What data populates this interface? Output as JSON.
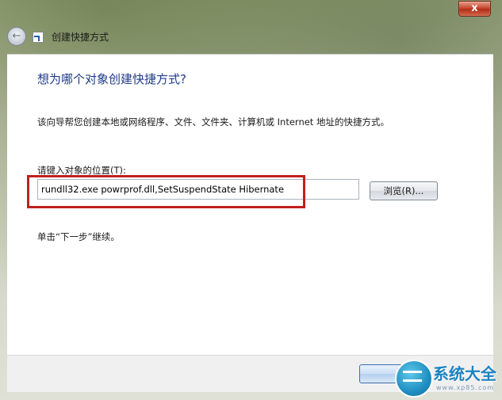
{
  "window": {
    "close_label": "x"
  },
  "nav": {
    "back_icon": "back-arrow-icon",
    "wizard_title": "创建快捷方式"
  },
  "main": {
    "heading": "想为哪个对象创建快捷方式?",
    "description": "该向导帮您创建本地或网络程序、文件、文件夹、计算机或 Internet 地址的快捷方式。",
    "location_label": "请键入对象的位置(T):",
    "location_value": "rundll32.exe powrprof.dll,SetSuspendState Hibernate",
    "browse_label": "浏览(R)...",
    "hint": "单击“下一步”继续。"
  },
  "watermark": {
    "brand": "系统大全",
    "url": "www.xp85.com"
  },
  "colors": {
    "heading": "#1e3a8a",
    "highlight": "#c0201f",
    "close_button": "#c84a31"
  }
}
